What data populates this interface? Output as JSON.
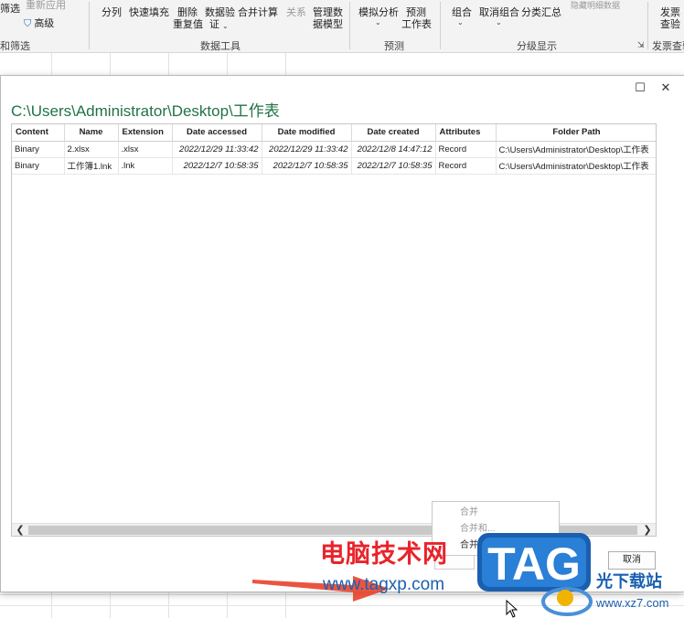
{
  "ribbon": {
    "row1": {
      "filter": "筛选",
      "reapply": "重新应用",
      "split": "分列",
      "flash_fill": "快速填充",
      "remove_dup_1": "删除",
      "data_val_1": "数据验",
      "consolidate": "合并计算",
      "relations": "关系",
      "manage_model_1": "管理数",
      "what_if": "模拟分析",
      "forecast_1": "预测",
      "group": "组合",
      "ungroup": "取消组合",
      "subtotal": "分类汇总",
      "hide_detail": "隐藏明细数据",
      "invoice_1": "发票"
    },
    "row2": {
      "advanced": "高级",
      "remove_dup_2": "重复值",
      "data_val_2": "证",
      "manage_model_2": "据模型",
      "forecast_2": "工作表",
      "invoice_2": "查验"
    },
    "groups": {
      "sort_filter": "和筛选",
      "data_tools": "数据工具",
      "forecast": "预测",
      "outline": "分级显示",
      "invoice": "发票查验"
    }
  },
  "dialog": {
    "title": "C:\\Users\\Administrator\\Desktop\\工作表",
    "columns": [
      "Content",
      "Name",
      "Extension",
      "Date accessed",
      "Date modified",
      "Date created",
      "Attributes",
      "Folder Path"
    ],
    "rows": [
      [
        "Binary",
        "2.xlsx",
        ".xlsx",
        "2022/12/29 11:33:42",
        "2022/12/29 11:33:42",
        "2022/12/8 14:47:12",
        "Record",
        "C:\\Users\\Administrator\\Desktop\\工作表"
      ],
      [
        "Binary",
        "工作簿1.lnk",
        ".lnk",
        "2022/12/7 10:58:35",
        "2022/12/7 10:58:35",
        "2022/12/7 10:58:35",
        "Record",
        "C:\\Users\\Administrator\\Desktop\\工作表"
      ]
    ],
    "cancel_label": "取消",
    "menu_items": [
      "合并",
      "合并和...",
      "合并和加载到..."
    ]
  },
  "watermark": {
    "red_text": "电脑技术网",
    "url": "www.tagxp.com",
    "logo": "TAG",
    "cn_name": "光下载站",
    "site": "www.xz7.com"
  },
  "colors": {
    "title_green": "#217346",
    "accent_red": "#e8242b",
    "accent_blue": "#1a5fb0"
  }
}
